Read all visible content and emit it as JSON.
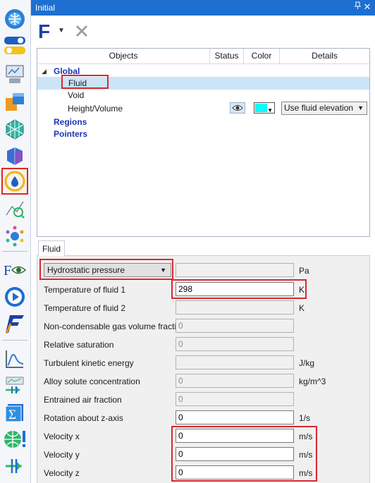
{
  "window": {
    "title": "Initial"
  },
  "toolbar": {
    "new_label": "F"
  },
  "tree": {
    "headers": {
      "objects": "Objects",
      "status": "Status",
      "color": "Color",
      "details": "Details"
    },
    "global": "Global",
    "fluid": "Fluid",
    "void": "Void",
    "height_volume": "Height/Volume",
    "height_volume_color": "#00ffff",
    "height_volume_detail": "Use fluid elevation",
    "regions": "Regions",
    "pointers": "Pointers"
  },
  "tab": {
    "label": "Fluid"
  },
  "form": {
    "pressure_type": "Hydrostatic pressure",
    "pressure_value": "",
    "pressure_unit": "Pa",
    "rows": [
      {
        "label": "Temperature of fluid 1",
        "value": "298",
        "unit": "K"
      },
      {
        "label": "Temperature of fluid 2",
        "value": "",
        "unit": "K"
      },
      {
        "label": "Non-condensable gas volume fraction",
        "value": "0",
        "unit": ""
      },
      {
        "label": "Relative saturation",
        "value": "0",
        "unit": ""
      },
      {
        "label": "Turbulent kinetic energy",
        "value": "",
        "unit": "J/kg"
      },
      {
        "label": "Alloy solute concentration",
        "value": "0",
        "unit": "kg/m^3"
      },
      {
        "label": "Entrained air fraction",
        "value": "0",
        "unit": ""
      },
      {
        "label": "Rotation about z-axis",
        "value": "0",
        "unit": "1/s"
      },
      {
        "label": "Velocity x",
        "value": "0",
        "unit": "m/s"
      },
      {
        "label": "Velocity y",
        "value": "0",
        "unit": "m/s"
      },
      {
        "label": "Velocity z",
        "value": "0",
        "unit": "m/s"
      }
    ]
  },
  "colors": {
    "titlebar": "#1d6fd1",
    "highlight": "#d9282f",
    "group_text": "#1b33b8",
    "selection": "#cce4f7"
  }
}
